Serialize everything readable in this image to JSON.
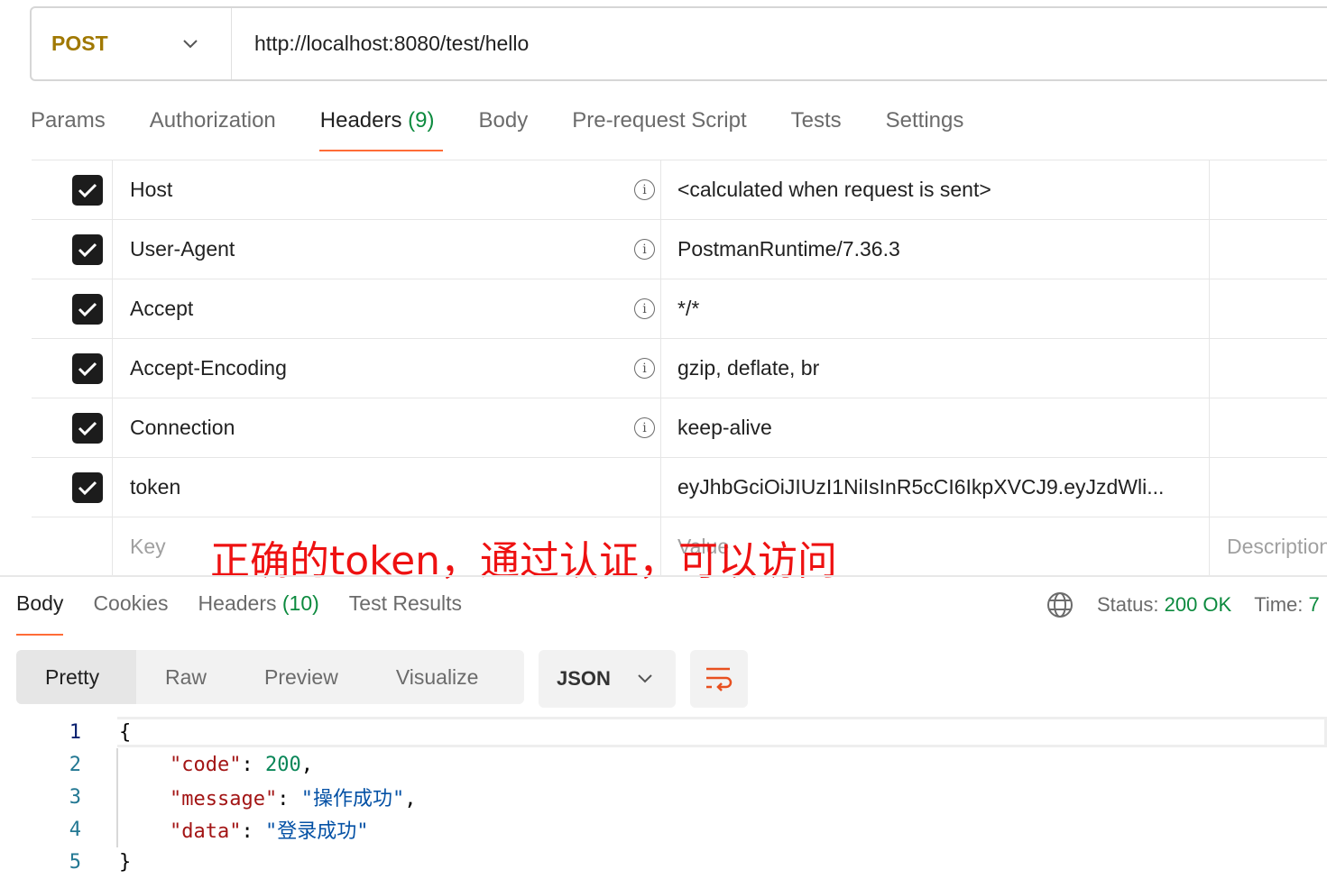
{
  "request": {
    "method": "POST",
    "url": "http://localhost:8080/test/hello"
  },
  "tabs": [
    {
      "label": "Params"
    },
    {
      "label": "Authorization"
    },
    {
      "label": "Headers",
      "count": "(9)"
    },
    {
      "label": "Body"
    },
    {
      "label": "Pre-request Script"
    },
    {
      "label": "Tests"
    },
    {
      "label": "Settings"
    }
  ],
  "headers": [
    {
      "key": "Host",
      "value": "<calculated when request is sent>",
      "checked": true,
      "info": true
    },
    {
      "key": "User-Agent",
      "value": "PostmanRuntime/7.36.3",
      "checked": true,
      "info": true
    },
    {
      "key": "Accept",
      "value": "*/*",
      "checked": true,
      "info": true
    },
    {
      "key": "Accept-Encoding",
      "value": "gzip, deflate, br",
      "checked": true,
      "info": true
    },
    {
      "key": "Connection",
      "value": "keep-alive",
      "checked": true,
      "info": true
    },
    {
      "key": "token",
      "value": "eyJhbGciOiJIUzI1NiIsInR5cCI6IkpXVCJ9.eyJzdWli...",
      "checked": true,
      "info": false
    }
  ],
  "new_row": {
    "key_placeholder": "Key",
    "value_placeholder": "Value",
    "description_placeholder": "Description"
  },
  "annotation": "正确的token，通过认证，可以访问",
  "response": {
    "tabs": [
      {
        "label": "Body"
      },
      {
        "label": "Cookies"
      },
      {
        "label": "Headers",
        "count": "(10)"
      },
      {
        "label": "Test Results"
      }
    ],
    "status_label": "Status:",
    "status_value": "200 OK",
    "time_label": "Time:",
    "time_value": "7",
    "views": [
      "Pretty",
      "Raw",
      "Preview",
      "Visualize"
    ],
    "format": "JSON",
    "code_lines": [
      "1",
      "2",
      "3",
      "4",
      "5"
    ],
    "body": {
      "code_key": "\"code\"",
      "code_val": "200",
      "message_key": "\"message\"",
      "message_val": "\"操作成功\"",
      "data_key": "\"data\"",
      "data_val": "\"登录成功\""
    }
  },
  "colors": {
    "accent": "#ff6c37",
    "success": "#0c8a3e",
    "method": "#a07800",
    "annotation": "#ee1111"
  }
}
